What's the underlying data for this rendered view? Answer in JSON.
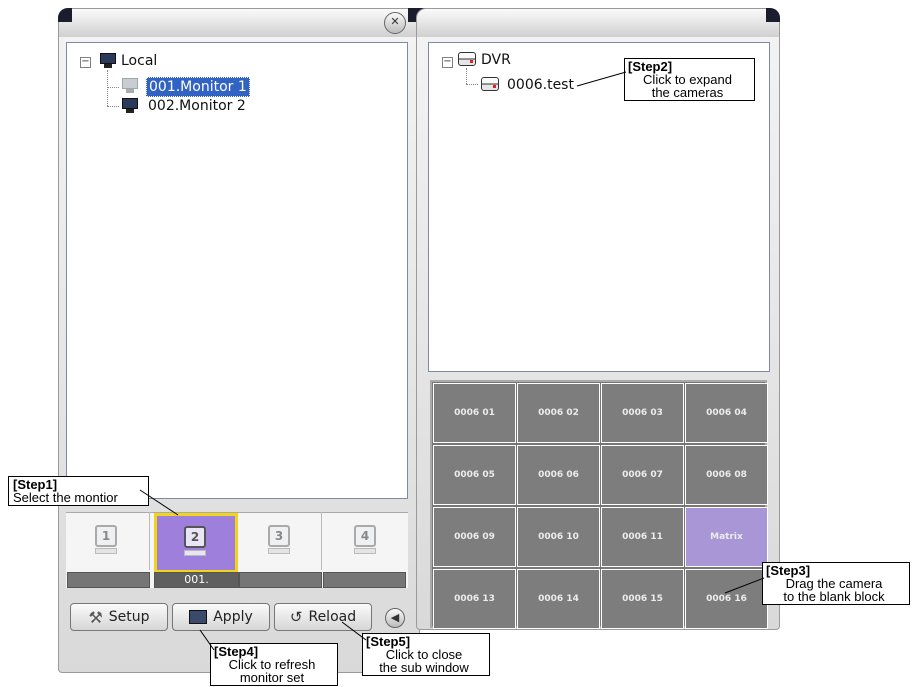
{
  "left_tree": {
    "root": "Local",
    "items": [
      "001.Monitor 1",
      "002.Monitor 2"
    ]
  },
  "right_tree": {
    "root": "DVR",
    "items": [
      "0006.test"
    ]
  },
  "monitor_slots": [
    {
      "number": "1",
      "label": ""
    },
    {
      "number": "2",
      "label": "001."
    },
    {
      "number": "3",
      "label": ""
    },
    {
      "number": "4",
      "label": ""
    }
  ],
  "buttons": {
    "setup": "Setup",
    "apply": "Apply",
    "reload": "Reload"
  },
  "camera_grid": [
    "0006 01",
    "0006 02",
    "0006 03",
    "0006 04",
    "0006 05",
    "0006 06",
    "0006 07",
    "0006 08",
    "0006 09",
    "0006 10",
    "0006 11",
    "Matrix",
    "0006 13",
    "0006 14",
    "0006 15",
    "0006 16"
  ],
  "callouts": {
    "step1": {
      "title": "[Step1]",
      "lines": [
        "Select the montior"
      ]
    },
    "step2": {
      "title": "[Step2]",
      "lines": [
        "Click to expand",
        "the cameras"
      ]
    },
    "step3": {
      "title": "[Step3]",
      "lines": [
        "Drag the camera",
        "to the blank block"
      ]
    },
    "step4": {
      "title": "[Step4]",
      "lines": [
        "Click to refresh",
        "monitor set"
      ]
    },
    "step5": {
      "title": "[Step5]",
      "lines": [
        "Click to close",
        "the sub window"
      ]
    }
  },
  "icons": {
    "close": "close-icon",
    "collapse": "chevron-left-icon",
    "setup": "tools-icon",
    "apply": "monitor-check-icon",
    "reload": "reload-icon"
  },
  "colors": {
    "selection": "#3163c5",
    "active_slot": "#9e7fdc",
    "active_slot_border": "#f1d51a",
    "camera_cell": "#7d7d7d",
    "matrix_cell": "#a896d6"
  }
}
